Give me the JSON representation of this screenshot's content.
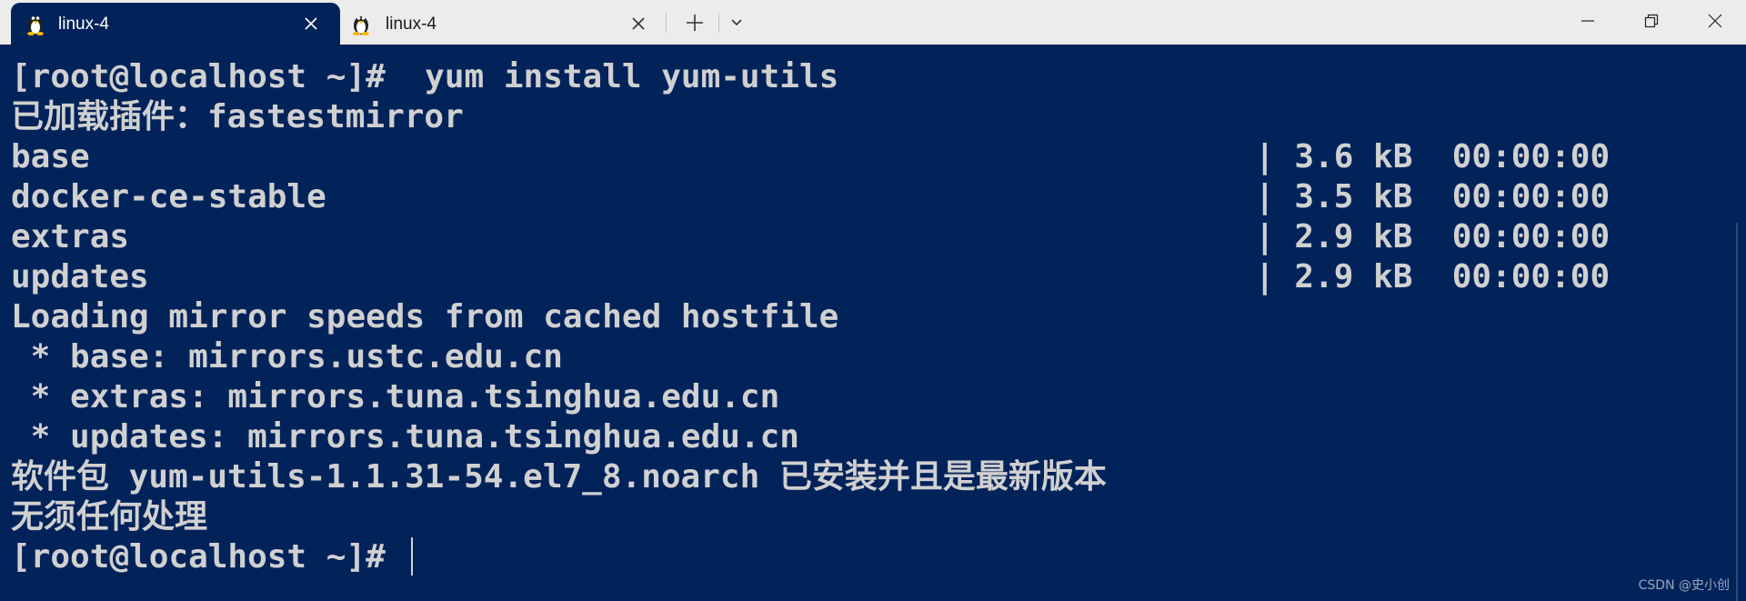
{
  "tabs": [
    {
      "label": "linux-4",
      "active": true,
      "icon": "linux-penguin-icon"
    },
    {
      "label": "linux-4",
      "active": false,
      "icon": "linux-penguin-icon"
    }
  ],
  "window_controls": {
    "minimize_icon": "minimize-icon",
    "maximize_icon": "restore-icon",
    "close_icon": "close-icon"
  },
  "terminal": {
    "lines": [
      "[root@localhost ~]#  yum install yum-utils",
      "已加载插件：fastestmirror",
      "base",
      "docker-ce-stable",
      "extras",
      "updates",
      "Loading mirror speeds from cached hostfile",
      " * base: mirrors.ustc.edu.cn",
      " * extras: mirrors.tuna.tsinghua.edu.cn",
      " * updates: mirrors.tuna.tsinghua.edu.cn",
      "软件包 yum-utils-1.1.31-54.el7_8.noarch 已安装并且是最新版本",
      "无须任何处理",
      "[root@localhost ~]# "
    ],
    "repo_stats": [
      "| 3.6 kB  00:00:00",
      "| 3.5 kB  00:00:00",
      "| 2.9 kB  00:00:00",
      "| 2.9 kB  00:00:00"
    ]
  },
  "watermark": "CSDN @史小创",
  "colors": {
    "terminal_bg": "#01235a",
    "terminal_fg": "#d0d0d0",
    "tabbar_bg": "#ececec"
  }
}
